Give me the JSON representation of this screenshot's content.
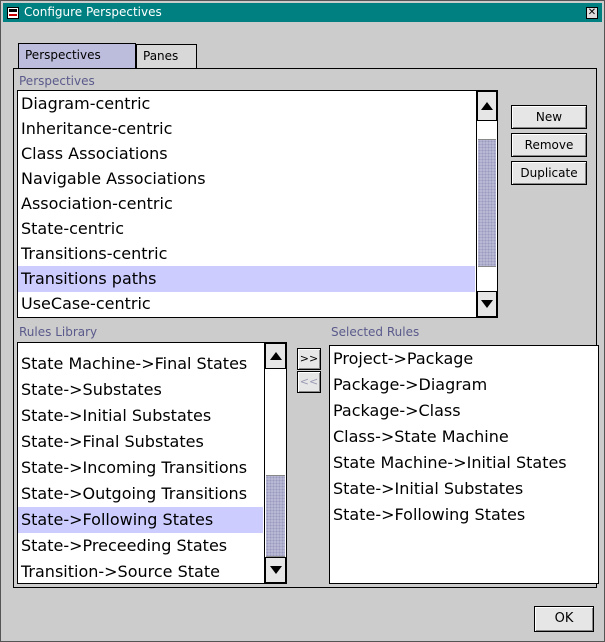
{
  "window": {
    "title": "Configure Perspectives",
    "close_glyph": "✕"
  },
  "tabs": {
    "perspectives": "Perspectives",
    "panes": "Panes"
  },
  "perspectives": {
    "label": "Perspectives",
    "items": [
      "Diagram-centric",
      "Inheritance-centric",
      "Class Associations",
      "Navigable Associations",
      "Association-centric",
      "State-centric",
      "Transitions-centric",
      "Transitions paths",
      "UseCase-centric"
    ],
    "selected": "Transitions paths",
    "buttons": {
      "new": "New",
      "remove": "Remove",
      "duplicate": "Duplicate"
    }
  },
  "rules_library": {
    "label": "Rules Library",
    "items": [
      "State Machine->Final States",
      "State->Substates",
      "State->Initial Substates",
      "State->Final Substates",
      "State->Incoming Transitions",
      "State->Outgoing Transitions",
      "State->Following States",
      "State->Preceeding States",
      "Transition->Source State"
    ],
    "selected": "State->Following States"
  },
  "transfer": {
    "add": ">>",
    "remove": "<<"
  },
  "selected_rules": {
    "label": "Selected Rules",
    "items": [
      "Project->Package",
      "Package->Diagram",
      "Package->Class",
      "Class->State Machine",
      "State Machine->Initial States",
      "State->Initial Substates",
      "State->Following States"
    ]
  },
  "ok_label": "OK"
}
